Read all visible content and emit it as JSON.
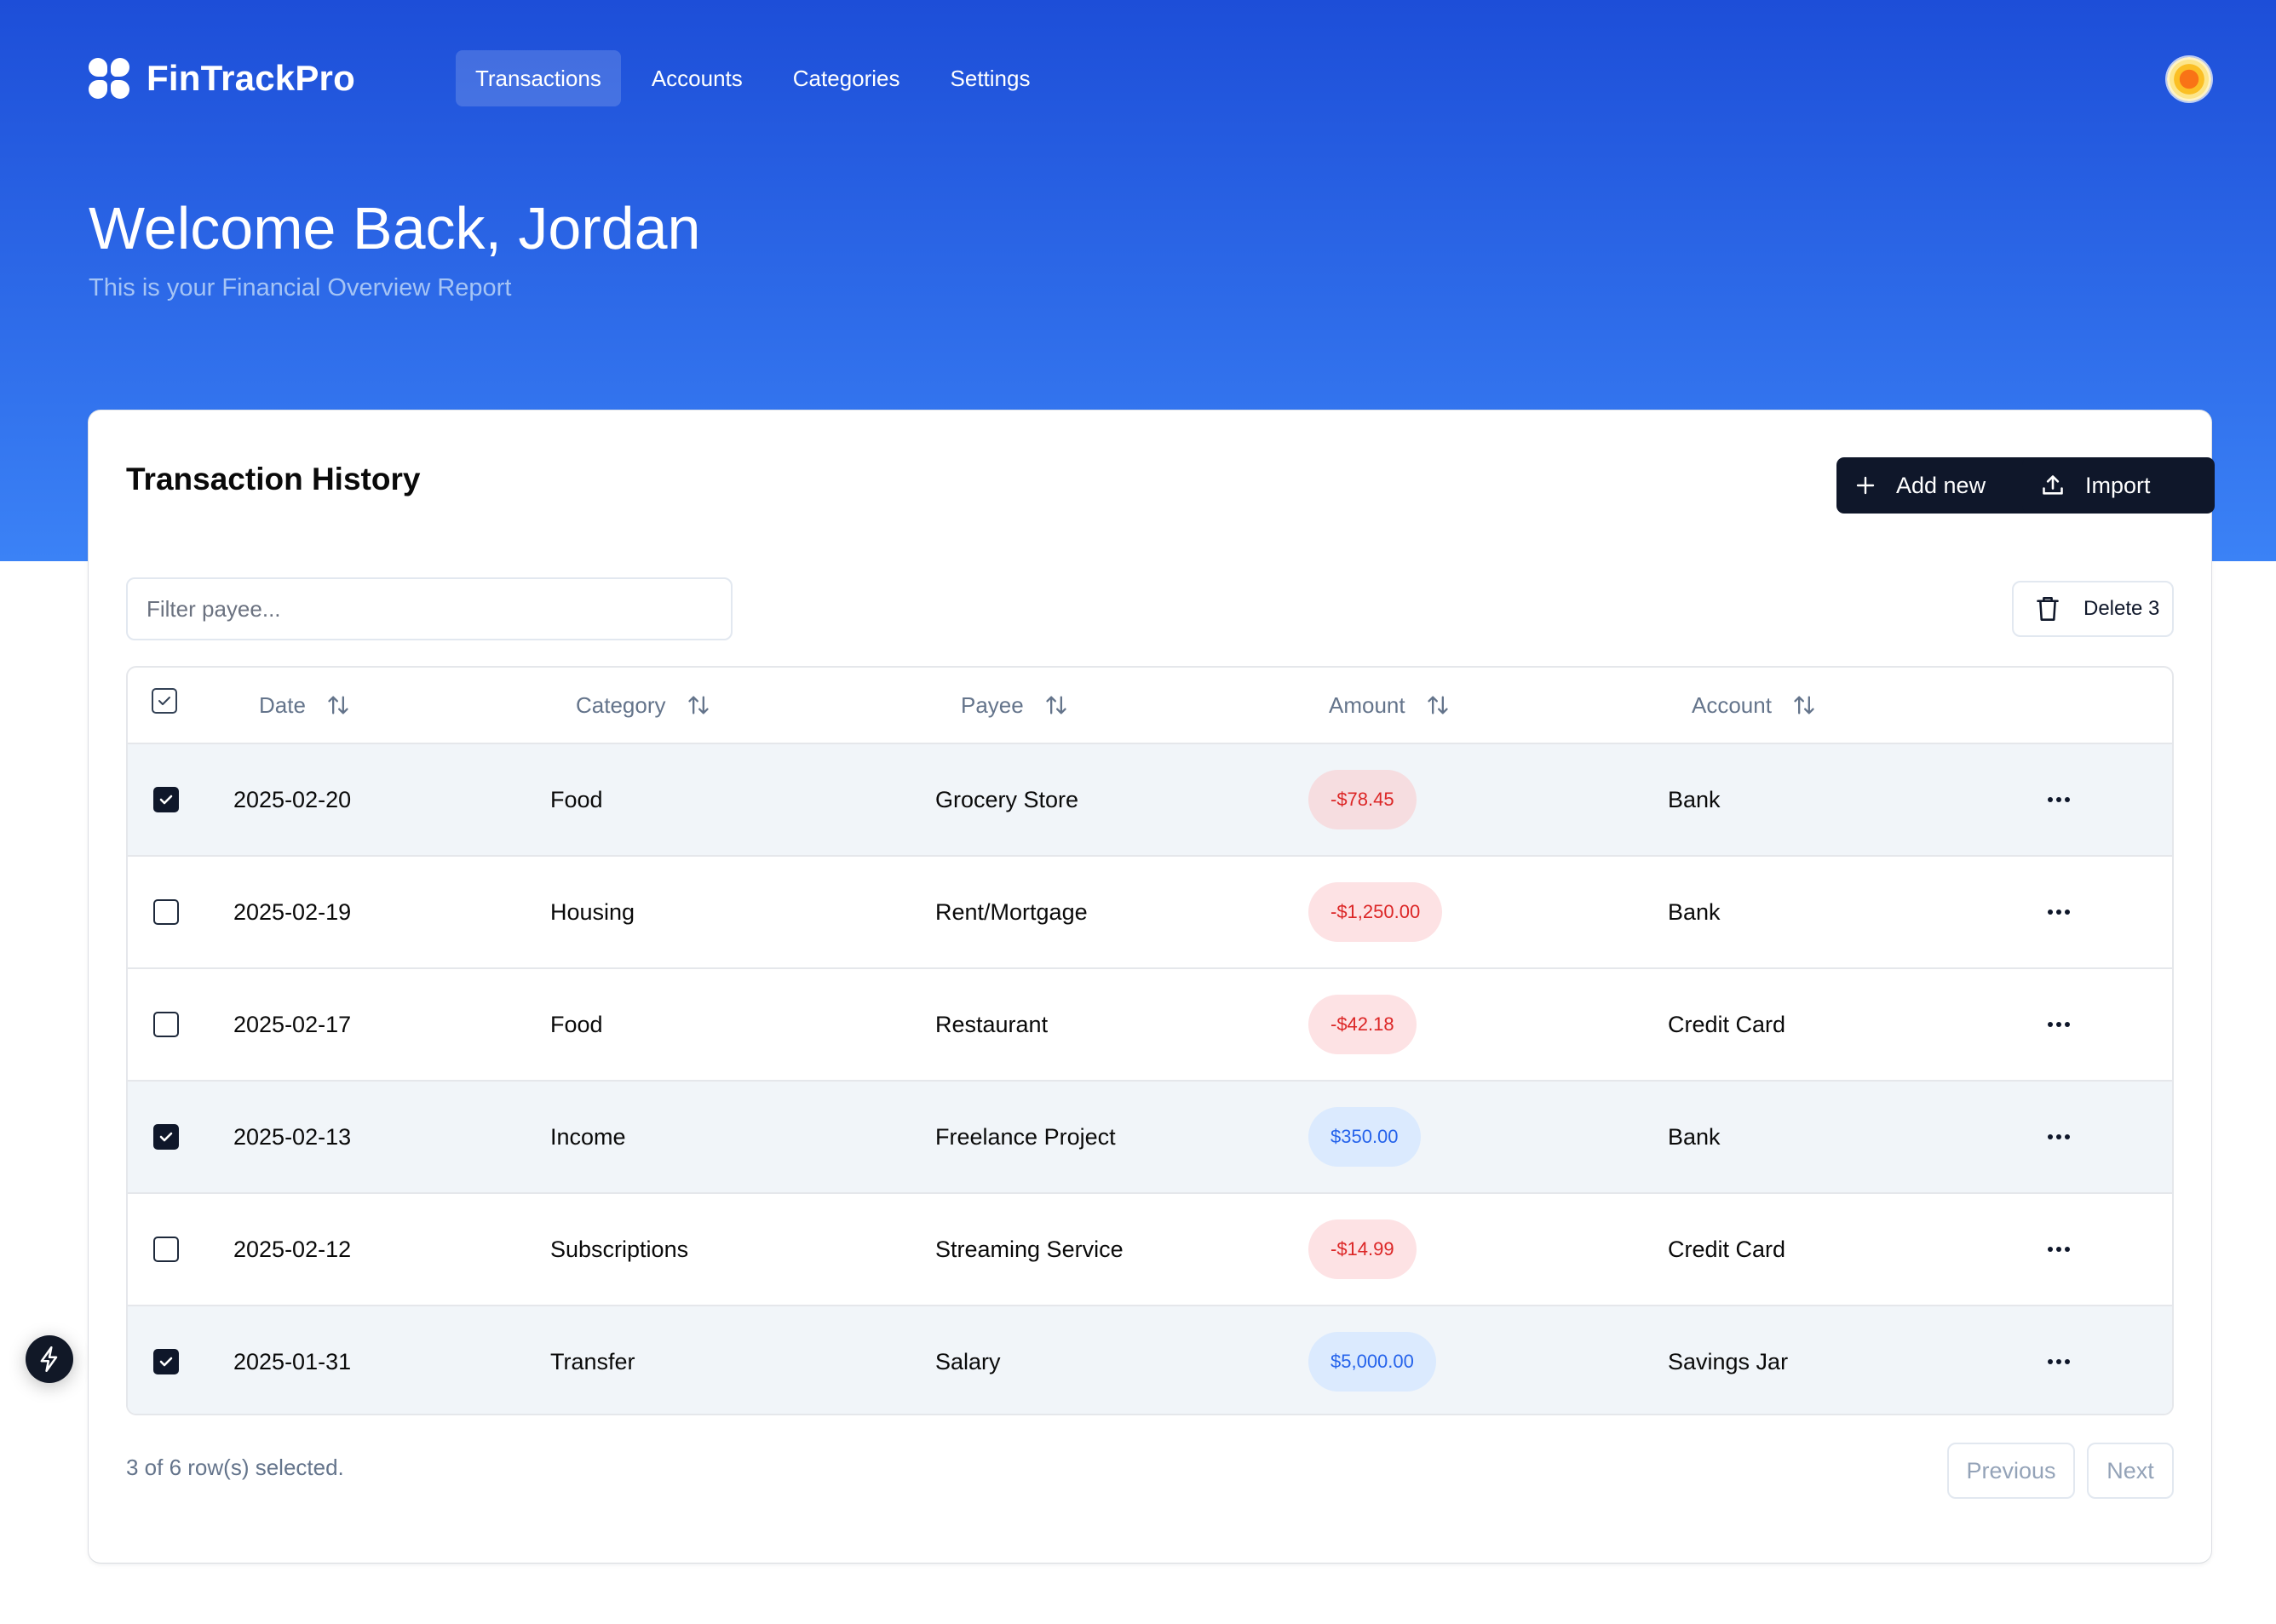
{
  "app": {
    "name": "FinTrackPro"
  },
  "nav": {
    "items": [
      {
        "label": "Transactions",
        "active": true
      },
      {
        "label": "Accounts",
        "active": false
      },
      {
        "label": "Categories",
        "active": false
      },
      {
        "label": "Settings",
        "active": false
      }
    ]
  },
  "hero": {
    "title": "Welcome Back, Jordan",
    "subtitle": "This is your Financial Overview Report"
  },
  "card": {
    "title": "Transaction History",
    "add_label": "Add new",
    "import_label": "Import",
    "filter_placeholder": "Filter payee...",
    "delete_label": "Delete 3"
  },
  "table": {
    "columns": [
      "Date",
      "Category",
      "Payee",
      "Amount",
      "Account"
    ],
    "rows": [
      {
        "selected": true,
        "date": "2025-02-20",
        "category": "Food",
        "payee": "Grocery Store",
        "amount": "-$78.45",
        "amount_type": "negative",
        "account": "Bank"
      },
      {
        "selected": false,
        "date": "2025-02-19",
        "category": "Housing",
        "payee": "Rent/Mortgage",
        "amount": "-$1,250.00",
        "amount_type": "negative",
        "account": "Bank"
      },
      {
        "selected": false,
        "date": "2025-02-17",
        "category": "Food",
        "payee": "Restaurant",
        "amount": "-$42.18",
        "amount_type": "negative",
        "account": "Credit Card"
      },
      {
        "selected": true,
        "date": "2025-02-13",
        "category": "Income",
        "payee": "Freelance Project",
        "amount": "$350.00",
        "amount_type": "positive",
        "account": "Bank"
      },
      {
        "selected": false,
        "date": "2025-02-12",
        "category": "Subscriptions",
        "payee": "Streaming Service",
        "amount": "-$14.99",
        "amount_type": "negative",
        "account": "Credit Card"
      },
      {
        "selected": true,
        "date": "2025-01-31",
        "category": "Transfer",
        "payee": "Salary",
        "amount": "$5,000.00",
        "amount_type": "positive",
        "account": "Savings Jar"
      }
    ]
  },
  "footer": {
    "selection_text": "3 of 6 row(s) selected.",
    "previous_label": "Previous",
    "next_label": "Next"
  },
  "colors": {
    "hero_top": "#1d4ed8",
    "hero_bottom": "#3b82f6",
    "primary_button": "#0f172a",
    "negative_text": "#dc2626",
    "positive_text": "#2563eb"
  },
  "icons": {
    "logo": "clover-logo-icon",
    "add": "plus-icon",
    "import": "upload-icon",
    "delete": "trash-icon",
    "sort": "sort-arrows-icon",
    "row_actions": "more-horizontal-icon",
    "floating": "lightning-bolt-icon"
  }
}
